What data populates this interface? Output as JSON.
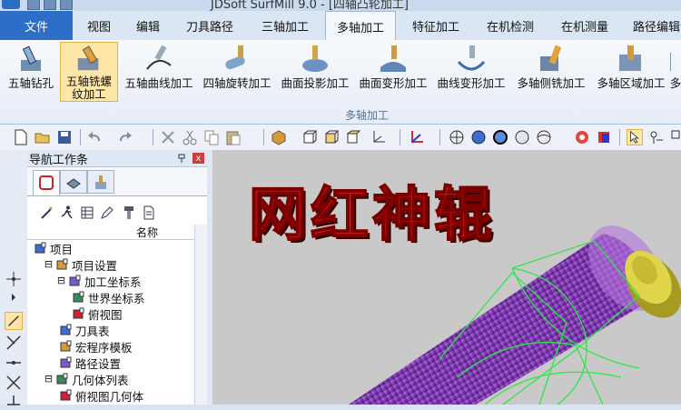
{
  "window": {
    "title": "JDSoft SurfMill 9.0 - [四轴凸轮加工]"
  },
  "menu": {
    "file": "文件",
    "tabs": [
      "视图",
      "编辑",
      "刀具路径",
      "三轴加工",
      "多轴加工",
      "特征加工",
      "在机检测",
      "在机测量",
      "路径编辑"
    ],
    "active_tab": "多轴加工"
  },
  "ribbon": {
    "group_label": "多轴加工",
    "buttons": [
      {
        "label": "五轴钻孔",
        "icon": "five-axis-drill-icon"
      },
      {
        "label": "五轴铣螺\n纹加工",
        "icon": "five-axis-thread-mill-icon",
        "selected": true
      },
      {
        "label": "五轴曲线加工",
        "icon": "five-axis-curve-icon"
      },
      {
        "label": "四轴旋转加工",
        "icon": "four-axis-rotary-icon"
      },
      {
        "label": "曲面投影加工",
        "icon": "surface-projection-icon"
      },
      {
        "label": "曲面变形加工",
        "icon": "surface-morph-icon"
      },
      {
        "label": "曲线变形加工",
        "icon": "curve-morph-icon"
      },
      {
        "label": "多轴侧铣加工",
        "icon": "multi-axis-side-mill-icon"
      },
      {
        "label": "多轴区域加工",
        "icon": "multi-axis-area-icon"
      },
      {
        "label": "多",
        "icon": "more-icon"
      }
    ]
  },
  "nav": {
    "title": "导航工作条",
    "pin_icon": "pin-icon",
    "close": "x",
    "column_header": "名称",
    "tree": [
      {
        "label": "项目",
        "level": 0,
        "expander": "",
        "icon": "project-icon"
      },
      {
        "label": "项目设置",
        "level": 1,
        "expander": "⊟",
        "icon": "settings-icon"
      },
      {
        "label": "加工坐标系",
        "level": 2,
        "expander": "⊟",
        "icon": "coordinate-icon"
      },
      {
        "label": "世界坐标系",
        "level": 3,
        "expander": "",
        "icon": "world-coordinate-icon"
      },
      {
        "label": "俯视图",
        "level": 3,
        "expander": "",
        "icon": "top-view-icon"
      },
      {
        "label": "刀具表",
        "level": 2,
        "expander": "",
        "icon": "tool-table-icon"
      },
      {
        "label": "宏程序模板",
        "level": 2,
        "expander": "",
        "icon": "macro-template-icon"
      },
      {
        "label": "路径设置",
        "level": 2,
        "expander": "",
        "icon": "path-settings-icon"
      },
      {
        "label": "几何体列表",
        "level": 1,
        "expander": "⊟",
        "icon": "geometry-list-icon"
      },
      {
        "label": "俯视图几何体",
        "level": 2,
        "expander": "",
        "icon": "geometry-icon"
      }
    ]
  },
  "viewport": {
    "overlay_text": "网红神辊"
  },
  "colors": {
    "accent": "#2d6fc8",
    "overlay_text": "#e31b1b",
    "part": "#8a3fbf",
    "toolpath": "#2ee64a",
    "end_cap": "#d8cc3a"
  }
}
